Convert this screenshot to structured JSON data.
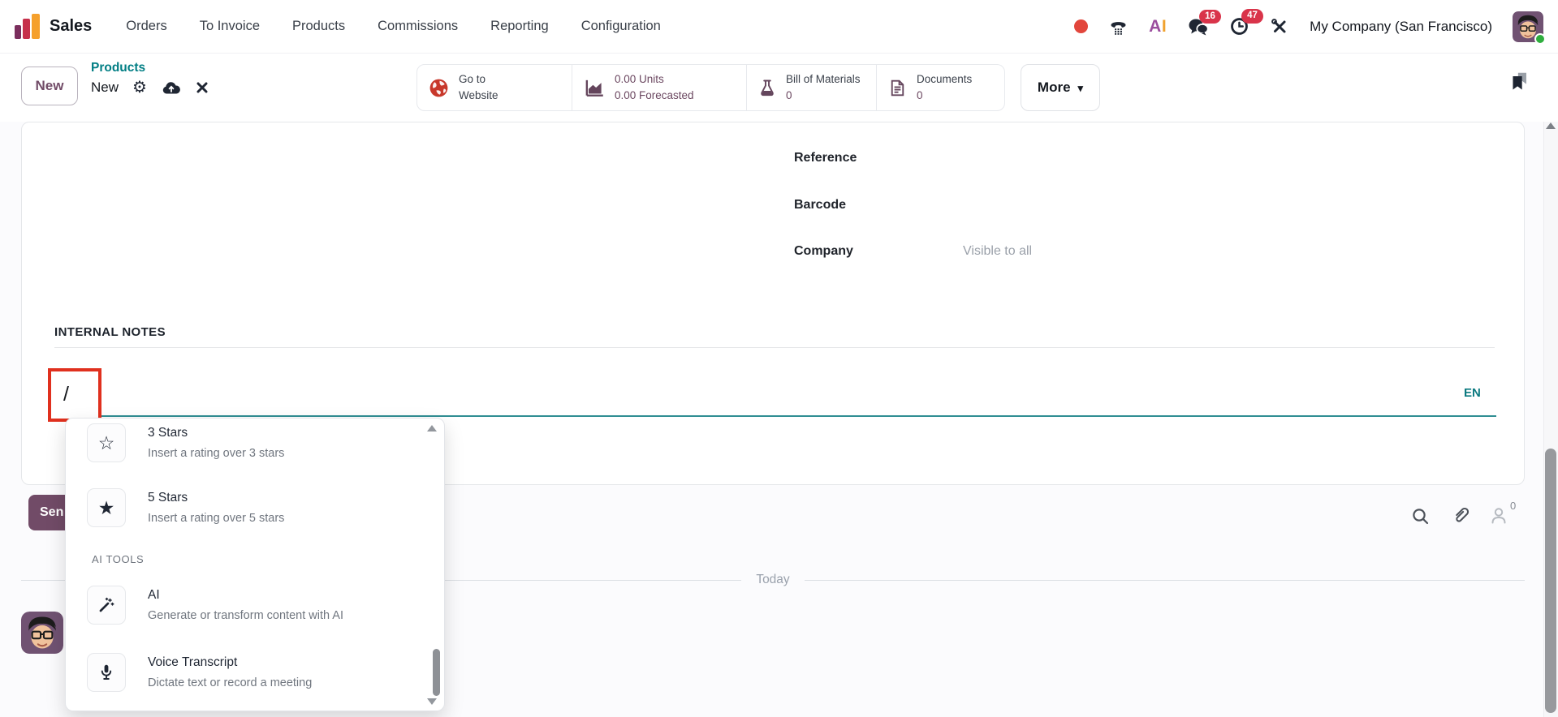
{
  "navbar": {
    "app_name": "Sales",
    "menu": [
      "Orders",
      "To Invoice",
      "Products",
      "Commissions",
      "Reporting",
      "Configuration"
    ],
    "systray": {
      "messages_badge": "16",
      "activities_badge": "47",
      "company": "My Company (San Francisco)"
    }
  },
  "control": {
    "new_label": "New",
    "breadcrumb": {
      "parent": "Products",
      "current": "New"
    },
    "stats": {
      "website": {
        "label": "Go to Website"
      },
      "units": {
        "value": "0.00 Units",
        "sub": "0.00 Forecasted"
      },
      "bom": {
        "label": "Bill of Materials",
        "value": "0"
      },
      "documents": {
        "label": "Documents",
        "value": "0"
      }
    },
    "more_label": "More"
  },
  "form": {
    "reference_label": "Reference",
    "barcode_label": "Barcode",
    "company_label": "Company",
    "company_placeholder": "Visible to all"
  },
  "notes": {
    "title": "INTERNAL NOTES",
    "typed": "/",
    "lang": "EN"
  },
  "powerbox": {
    "items": [
      {
        "title": "3 Stars",
        "description": "Insert a rating over 3 stars",
        "icon": "star-outline-icon"
      },
      {
        "title": "5 Stars",
        "description": "Insert a rating over 5 stars",
        "icon": "star-filled-icon"
      }
    ],
    "section": "AI TOOLS",
    "ai": [
      {
        "title": "AI",
        "description": "Generate or transform content with AI",
        "icon": "magic-wand-icon"
      },
      {
        "title": "Voice Transcript",
        "description": "Dictate text or record a meeting",
        "icon": "microphone-icon"
      }
    ]
  },
  "chatter": {
    "send_label": "Sen",
    "followers_count": "0",
    "today": "Today"
  },
  "icons": {
    "star_outline": "☆",
    "star_filled": "★",
    "gear": "⚙",
    "caret_down": "▾"
  },
  "colors": {
    "accent_teal": "#017e84",
    "primary_purple": "#714B67",
    "badge_red": "#d9344a",
    "highlight_red": "#e0301e",
    "globe_red": "#c8382b",
    "stat_icon_purple": "#64455c"
  }
}
